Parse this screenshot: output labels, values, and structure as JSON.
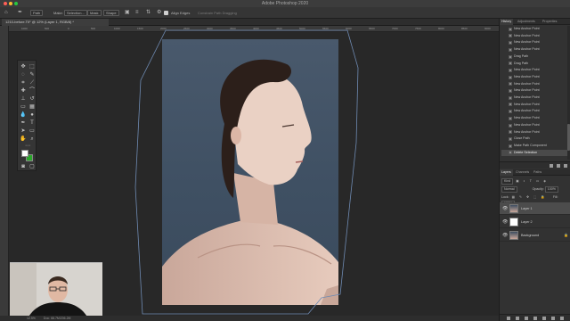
{
  "window": {
    "title": "Adobe Photoshop 2020"
  },
  "options_bar": {
    "items": [
      "Path",
      "Make:",
      "Selection...",
      "Mask",
      "Shape",
      "Align Edges",
      "Constrain Path Dragging"
    ]
  },
  "document_tab": {
    "label": "1210-before.TIF @ 12% (Layer 1, RGB/8) *"
  },
  "ruler": {
    "numbers": [
      "1000",
      "500",
      "0",
      "500",
      "1000",
      "1500",
      "2000",
      "2500",
      "3000",
      "3500",
      "4000",
      "4500",
      "5000",
      "5500",
      "6000",
      "6500",
      "7000",
      "7500",
      "8000",
      "8500",
      "9000"
    ]
  },
  "colors": {
    "foreground": "#ffffff",
    "background": "#2aa62a",
    "path_outline": "#6f8bb3"
  },
  "panels": {
    "top_tabs": [
      "History",
      "Adjustments",
      "Properties"
    ],
    "history_items": [
      "New Anchor Point",
      "New Anchor Point",
      "New Anchor Point",
      "New Anchor Point",
      "Drag Path",
      "Drag Path",
      "New Anchor Point",
      "New Anchor Point",
      "New Anchor Point",
      "New Anchor Point",
      "New Anchor Point",
      "New Anchor Point",
      "New Anchor Point",
      "New Anchor Point",
      "New Anchor Point",
      "New Anchor Point",
      "Close Path",
      "Make Path Component",
      "Delete Selection"
    ],
    "history_selected_index": 18,
    "layer_tabs": [
      "Layers",
      "Channels",
      "Paths"
    ],
    "kind_filter": "Kind",
    "blend_mode": "Normal",
    "opacity_label": "Opacity:",
    "opacity_value": "100%",
    "lock_label": "Lock:",
    "fill_label": "Fill:",
    "fill_value": "100%",
    "layers": [
      {
        "name": "Layer 1",
        "selected": true,
        "thumb": "portrait"
      },
      {
        "name": "Layer 2",
        "selected": false,
        "thumb": "white"
      },
      {
        "name": "Background",
        "selected": false,
        "thumb": "portrait",
        "locked": true
      }
    ]
  },
  "status_bar": {
    "zoom": "12.5%",
    "doc_info": "Doc: 68.7M/206.2M"
  }
}
